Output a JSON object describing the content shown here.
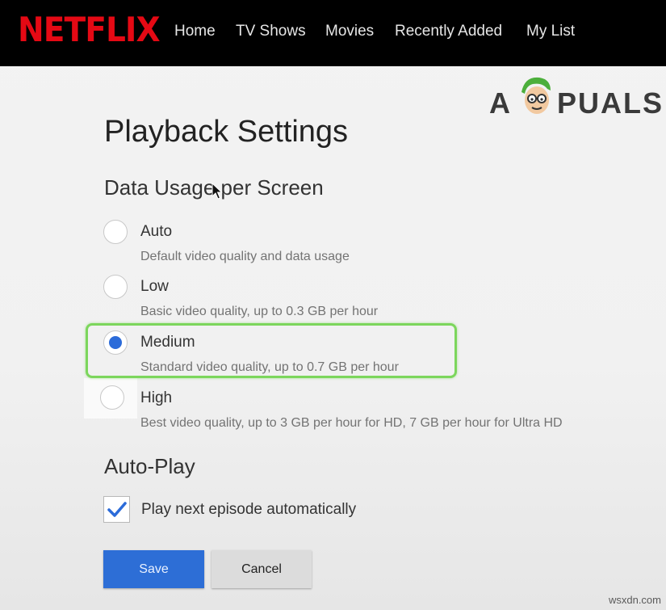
{
  "header": {
    "logo_text": "NETFLIX",
    "nav": [
      {
        "label": "Home"
      },
      {
        "label": "TV Shows"
      },
      {
        "label": "Movies"
      },
      {
        "label": "Recently Added"
      },
      {
        "label": "My List"
      }
    ]
  },
  "watermark": {
    "text_left": "A",
    "text_right": "PUALS"
  },
  "page": {
    "title": "Playback Settings"
  },
  "data_usage": {
    "title": "Data Usage per Screen",
    "selected": "Medium",
    "options": [
      {
        "label": "Auto",
        "description": "Default video quality and data usage",
        "checked": false
      },
      {
        "label": "Low",
        "description": "Basic video quality, up to 0.3 GB per hour",
        "checked": false
      },
      {
        "label": "Medium",
        "description": "Standard video quality, up to 0.7 GB per hour",
        "checked": true
      },
      {
        "label": "High",
        "description": "Best video quality, up to 3 GB per hour for HD, 7 GB per hour for Ultra HD",
        "checked": false
      }
    ]
  },
  "autoplay": {
    "title": "Auto-Play",
    "checkbox_label": "Play next episode automatically",
    "checked": true
  },
  "buttons": {
    "save_label": "Save",
    "cancel_label": "Cancel"
  },
  "footer": {
    "source_mark": "wsxdn.com"
  },
  "colors": {
    "brand_red": "#e50914",
    "selected_blue": "#2b6bd9",
    "save_button": "#2d6ed6",
    "highlight_green": "#7cd65c"
  },
  "icons": {
    "checkmark": "check-icon",
    "mouse": "mouse-pointer-icon",
    "mascot": "mascot-icon"
  }
}
